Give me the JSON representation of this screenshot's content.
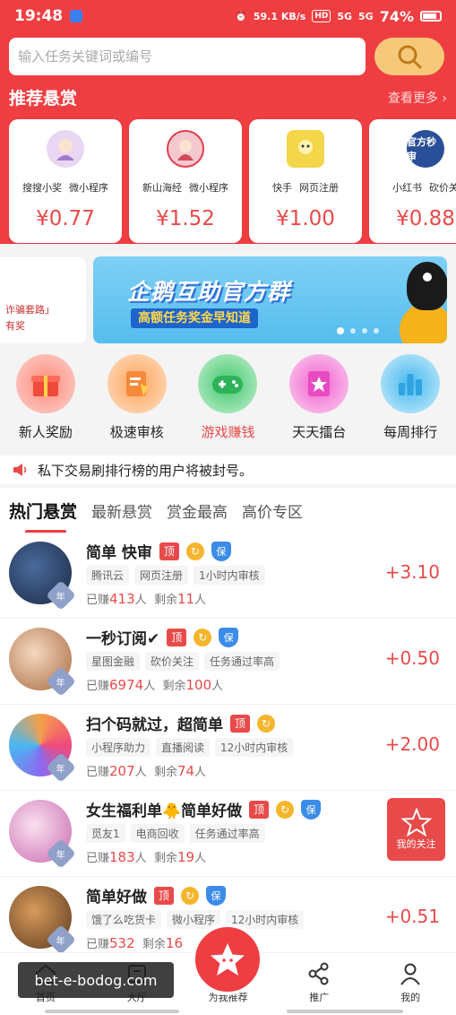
{
  "status_bar": {
    "time": "19:48",
    "net_speed": "59.1 KB/s",
    "hd": "HD",
    "signal1": "5G",
    "signal2": "5G",
    "battery": "74%"
  },
  "search": {
    "placeholder": "输入任务关键词或编号"
  },
  "recommend": {
    "title": "推荐悬赏",
    "more": "查看更多 ›",
    "cards": [
      {
        "tag1": "搜搜小奖",
        "tag2": "微小程序",
        "price": "¥0.77",
        "icon_color": "#e9d6f3"
      },
      {
        "tag1": "新山海经",
        "tag2": "微小程序",
        "price": "¥1.52",
        "icon_color": "#f3c9cf"
      },
      {
        "tag1": "快手",
        "tag2": "网页注册",
        "price": "¥1.00",
        "icon_color": "#f4d64a"
      },
      {
        "tag1": "小红书",
        "tag2": "砍价关",
        "price": "¥0.88",
        "icon_color": "#2a4f9a",
        "icon_text": "官方秒审"
      }
    ]
  },
  "banner": {
    "left_text1": "诈骗套路」",
    "left_text2": "有奖",
    "title": "企鹅互助官方群",
    "subtitle": "高额任务奖金早知道"
  },
  "quick_actions": [
    {
      "label": "新人奖励",
      "color": "#f86a6a",
      "icon": "gift-icon"
    },
    {
      "label": "极速审核",
      "color": "#f7934a",
      "icon": "document-icon"
    },
    {
      "label": "游戏赚钱",
      "color": "#4fce7a",
      "icon": "gamepad-icon"
    },
    {
      "label": "天天擂台",
      "color": "#f06fd6",
      "icon": "arena-icon"
    },
    {
      "label": "每周排行",
      "color": "#5bc4f0",
      "icon": "bar-chart-icon"
    }
  ],
  "notice": {
    "text": "私下交易刷排行榜的用户将被封号。"
  },
  "tabs": [
    "热门悬赏",
    "最新悬赏",
    "赏金最高",
    "高价专区"
  ],
  "tasks": [
    {
      "title": "简单 快审",
      "tags": [
        "腾讯云",
        "网页注册",
        "1小时内审核"
      ],
      "earned_label": "已赚",
      "earned": "413",
      "remain_label": "剩余",
      "remain": "11",
      "unit": "人",
      "reward": "+3.10",
      "avatar_color": "#2a3a5c",
      "year": "年",
      "shield": true
    },
    {
      "title": "一秒订阅✔",
      "tags": [
        "星图金融",
        "砍价关注",
        "任务通过率高"
      ],
      "earned_label": "已赚",
      "earned": "6974",
      "remain_label": "剩余",
      "remain": "100",
      "unit": "人",
      "reward": "+0.50",
      "avatar_color": "#c98a62",
      "year": "年",
      "shield": true
    },
    {
      "title": "扫个码就过，超简单",
      "tags": [
        "小程序助力",
        "直播阅读",
        "12小时内审核"
      ],
      "earned_label": "已赚",
      "earned": "207",
      "remain_label": "剩余",
      "remain": "74",
      "unit": "人",
      "reward": "+2.00",
      "avatar_color": "#f06a8a",
      "year": "年",
      "shield": false
    },
    {
      "title": "女生福利单🐥简单好做",
      "tags": [
        "觅友1",
        "电商回收",
        "任务通过率高"
      ],
      "earned_label": "已赚",
      "earned": "183",
      "remain_label": "剩余",
      "remain": "19",
      "unit": "人",
      "reward": "",
      "avatar_color": "#e8a2d8",
      "year": "年",
      "shield": true
    },
    {
      "title": "简单好做",
      "tags": [
        "饿了么吃货卡",
        "微小程序",
        "12小时内审核"
      ],
      "earned_label": "已赚",
      "earned": "532",
      "remain_label": "剩余",
      "remain": "16",
      "unit": "",
      "reward": "+0.51",
      "avatar_color": "#8a5a30",
      "year": "年",
      "shield": true
    }
  ],
  "badges": {
    "top": "顶",
    "refresh": "↻",
    "shield": "保"
  },
  "fav_button": {
    "label": "我的关注"
  },
  "bottom_nav": [
    {
      "label": "首页",
      "icon": "home-icon"
    },
    {
      "label": "大厅",
      "icon": "hall-icon"
    },
    {
      "label": "为我推荐",
      "icon": "star-icon"
    },
    {
      "label": "推广",
      "icon": "share-icon"
    },
    {
      "label": "我的",
      "icon": "user-icon"
    }
  ],
  "watermark": "bet-e-bodog.com",
  "colors": {
    "primary": "#ef3e42",
    "price": "#e84a4a",
    "search_btn": "#f6c97a"
  }
}
